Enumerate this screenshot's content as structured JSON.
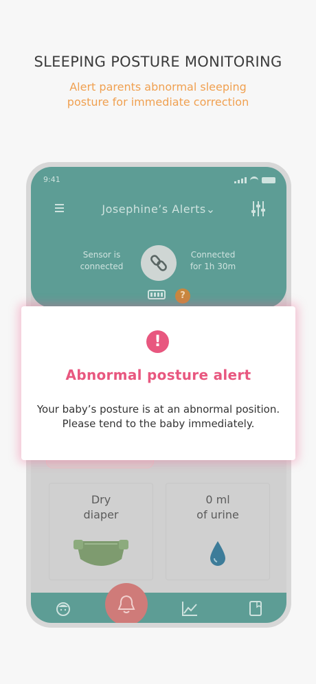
{
  "header": {
    "title": "SLEEPING POSTURE MONITORING",
    "subtitle_lines": [
      "Alert parents abnormal sleeping",
      "posture for immediate correction"
    ]
  },
  "phone": {
    "status_time": "9:41",
    "app_title": "Josephine’s Alerts",
    "title_chevron": "⌄",
    "sensor_status": [
      "Sensor is",
      "connected"
    ],
    "connection_time": [
      "Connected",
      "for 1h 30m"
    ],
    "help_label": "?",
    "icons": [
      "menu-icon",
      "sliders-icon",
      "link-icon",
      "battery-icon",
      "help-icon",
      "diaper-icon",
      "drop-icon",
      "baby-face-icon",
      "bell-icon",
      "chart-icon",
      "notebook-icon"
    ],
    "cards": [
      {
        "title_lines": [
          "Dry",
          "diaper"
        ]
      },
      {
        "title_lines": [
          "0 ml",
          "of urine"
        ]
      }
    ]
  },
  "modal": {
    "icon_label": "!",
    "title": "Abnormal posture alert",
    "body_lines": [
      "Your baby’s posture is at an abnormal position.",
      "Please tend to the baby immediately."
    ]
  },
  "colors": {
    "teal": "#5d9d95",
    "alert_pink": "#e8577f",
    "subtitle_orange": "#f0a050",
    "bell_red": "#cf7b79"
  }
}
